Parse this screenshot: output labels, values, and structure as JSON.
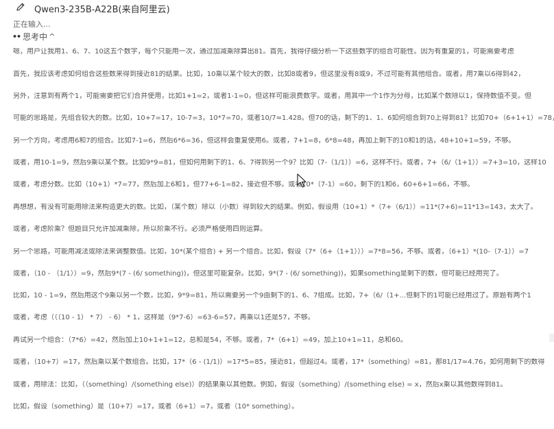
{
  "header": {
    "title": "Qwen3-235B-A22B(来自阿里云)",
    "edit_icon": "pencil-icon"
  },
  "status": "正在输入...",
  "thinking": {
    "label": "思考中",
    "caret": "^",
    "dots": "••"
  },
  "lines": [
    "嗯，用户让我用1、6、7、10这五个数字，每个只能用一次，通过加减乘除算出81。首先，我得仔细分析一下这些数字的组合可能性。因为有重复的1，可能需要考虑",
    "首先，我应该考虑如何组合这些数来得到接近81的结果。比如，10乘以某个较大的数，比如8或者9，但这里没有8或9，不过可能有其他组合。或者，用7乘以6得到42，",
    "另外，注意到有两个1，可能需要把它们合并使用，比如1+1=2，或者1-1=0，但这样可能浪费数字。或者，用其中一个1作为分母，比如某个数除以1，保持数值不变。但",
    "可能的思路是，先组合较大的数。比如，10+7=17，10-7=3，10*7=70，或者10/7≈1.428。但70的话，剩下的1、1、6如何组合到70上得到81？比如70+（6+1+1）=78，不",
    "另一个方向，考虑用6和7的组合。比如7-1=6，然后6*6=36，但这样会重复使用6。或者，7+1=8，6*8=48，再加上剩下的10和1的话，48+10+1=59，不够。",
    "或者，用10-1=9，然后9乘以某个数。比如9*9=81，但如何用剩下的1、6、7得到另一个9？比如（7-（1/1））=6，这样不行。或者，7+（6/（1+1））=7+3=10，这样10",
    "或者，考虑分数。比如（10+1）*7=77，然后加上6和1，但77+6-1=82，接近但不够。或者10*（7-1）=60，剩下的1和6，60+6+1=66，不够。",
    "再想想，有没有可能用除法来构造更大的数。比如，（某个数）除以（小数）得到较大的结果。例如，假设用（10+1）*（7+（6/1））=11*(7+6)=11*13=143，太大了。",
    "或者，考虑阶乘？但题目只允许加减乘除，所以阶乘不行。必须严格使用四则运算。",
    "另一个思路，可能用减法或除法来调整数值。比如，10*(某个组合) + 另一个组合。比如，假设（7*（6+（1+1）））=7*8=56，不够。或者，（6+1）*(10-（7-1））=7",
    "或者，（10 - （1/1））=9，然后9*(7 - (6/ something))，但这里可能复杂。比如，9*(7 - (6/ something))，如果something是剩下的数，但可能已经用完了。",
    "比如，10 - 1=9，然后用这个9乘以另一个数，比如，9*9=81，所以需要另一个9由剩下的1、6、7组成。比如，7+（6/（1+...但剩下的1可能已经用过了。原题有两个1",
    "或者，考虑（（（10 - 1） * 7） - 6） * 1，这样是（9*7-6）=63-6=57，再乘以1还是57，不够。",
    "再试另一个组合：（7*6）=42，然后加上10+1+1=12，总和是54，不够。或者，7*（6+1）=49，加上10+1=11，总和60。",
    "或者，（10+7）=17，然后乘以某个数组合。比如，17*（6 - (1/1)）=17*5=85，接近81，但超过4。或者，17*（something）=81，那81/17≈4.76，如何用剩下的数得",
    "或者，用除法：比如，（（something）/(something else)）的结果乘以其他数。例如，假设（something）/(something else) = x，然后x乘以其他数得到81。",
    "比如，假设（something）是（10+7）=17，或者（6+1）=7，或者（10* something）。"
  ]
}
